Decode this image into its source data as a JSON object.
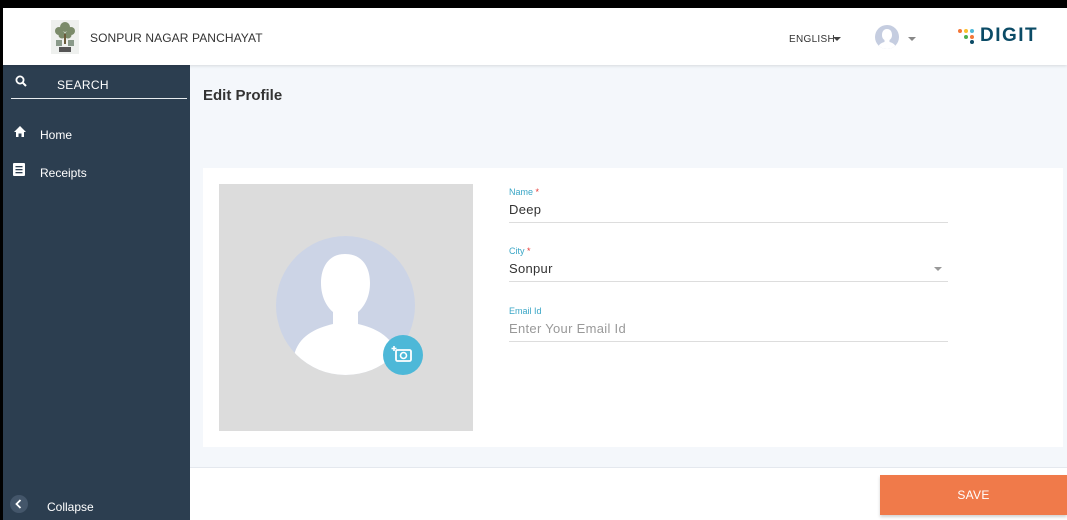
{
  "header": {
    "brand_name": "SONPUR NAGAR PANCHAYAT",
    "language": "ENGLISH",
    "digit_logo_text": "DIGIT",
    "icons": [
      "emblem-logo",
      "chevron-down-icon",
      "user-avatar-icon",
      "digit-logo"
    ]
  },
  "sidebar": {
    "search_label": "SEARCH",
    "items": [
      {
        "label": "Home",
        "icon": "home-icon"
      },
      {
        "label": "Receipts",
        "icon": "receipt-icon"
      }
    ],
    "collapse_label": "Collapse"
  },
  "main": {
    "title": "Edit Profile",
    "form": {
      "name": {
        "label": "Name",
        "required_mark": "*",
        "value": "Deep"
      },
      "city": {
        "label": "City",
        "required_mark": "*",
        "value": "Sonpur"
      },
      "email": {
        "label": "Email Id",
        "placeholder": "Enter Your Email Id"
      }
    }
  },
  "footer": {
    "save_label": "SAVE"
  },
  "colors": {
    "sidebar_bg": "#2c3e50",
    "accent_label": "#3aa6c6",
    "camera_button": "#4db8d8",
    "save_button": "#f07a4a",
    "required": "#e53935"
  }
}
